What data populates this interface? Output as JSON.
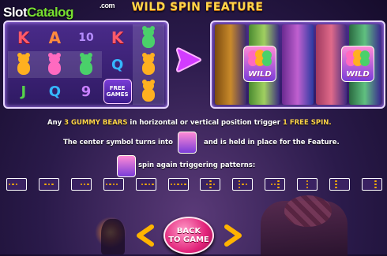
{
  "logo": {
    "part1": "Slot",
    "part2": "Catalog",
    "suffix": ".com"
  },
  "title": "WILD SPIN FEATURE",
  "reels_before": [
    [
      "K",
      "A",
      "10",
      "K",
      "bear-green"
    ],
    [
      "bear-yellow",
      "bear-pink",
      "bear-green",
      "Q",
      "bear-yellow"
    ],
    [
      "J",
      "Q",
      "9",
      "FREE GAMES",
      "bear-yellow"
    ]
  ],
  "free_games_label": {
    "line1": "FREE",
    "line2": "GAMES"
  },
  "wild_label": "WILD",
  "line1": {
    "pre": "Any ",
    "highlight1": "3 GUMMY BEARS",
    "mid": " in horizontal or vertical position trigger ",
    "highlight2": "1 FREE SPIN."
  },
  "line2": {
    "pre": "The center symbol turns into",
    "post": "and is held in place for the Feature."
  },
  "line3": "spin again triggering patterns:",
  "patterns": [
    [
      [
        1,
        0
      ],
      [
        1,
        1
      ],
      [
        1,
        2
      ]
    ],
    [
      [
        1,
        1
      ],
      [
        1,
        2
      ],
      [
        1,
        3
      ]
    ],
    [
      [
        1,
        2
      ],
      [
        1,
        3
      ],
      [
        1,
        4
      ]
    ],
    [
      [
        1,
        0
      ],
      [
        1,
        1
      ],
      [
        1,
        2
      ],
      [
        1,
        3
      ]
    ],
    [
      [
        1,
        1
      ],
      [
        1,
        2
      ],
      [
        1,
        3
      ],
      [
        1,
        4
      ]
    ],
    [
      [
        1,
        0
      ],
      [
        1,
        1
      ],
      [
        1,
        2
      ],
      [
        1,
        3
      ],
      [
        1,
        4
      ]
    ],
    [
      [
        0,
        2
      ],
      [
        1,
        2
      ],
      [
        2,
        2
      ],
      [
        1,
        1
      ],
      [
        1,
        3
      ]
    ],
    [
      [
        0,
        1
      ],
      [
        1,
        1
      ],
      [
        2,
        1
      ],
      [
        1,
        2
      ],
      [
        1,
        3
      ]
    ],
    [
      [
        0,
        3
      ],
      [
        1,
        3
      ],
      [
        2,
        3
      ],
      [
        1,
        1
      ],
      [
        1,
        2
      ]
    ],
    [
      [
        0,
        2
      ],
      [
        1,
        2
      ],
      [
        2,
        2
      ]
    ],
    [
      [
        0,
        1
      ],
      [
        1,
        1
      ],
      [
        2,
        1
      ]
    ],
    [
      [
        0,
        3
      ],
      [
        1,
        3
      ],
      [
        2,
        3
      ]
    ]
  ],
  "back_button": {
    "line1": "BACK",
    "line2": "TO GAME"
  },
  "colors": {
    "accent": "#ffd54a",
    "pattern_on": "#ffb000",
    "button": "#e2247a"
  }
}
